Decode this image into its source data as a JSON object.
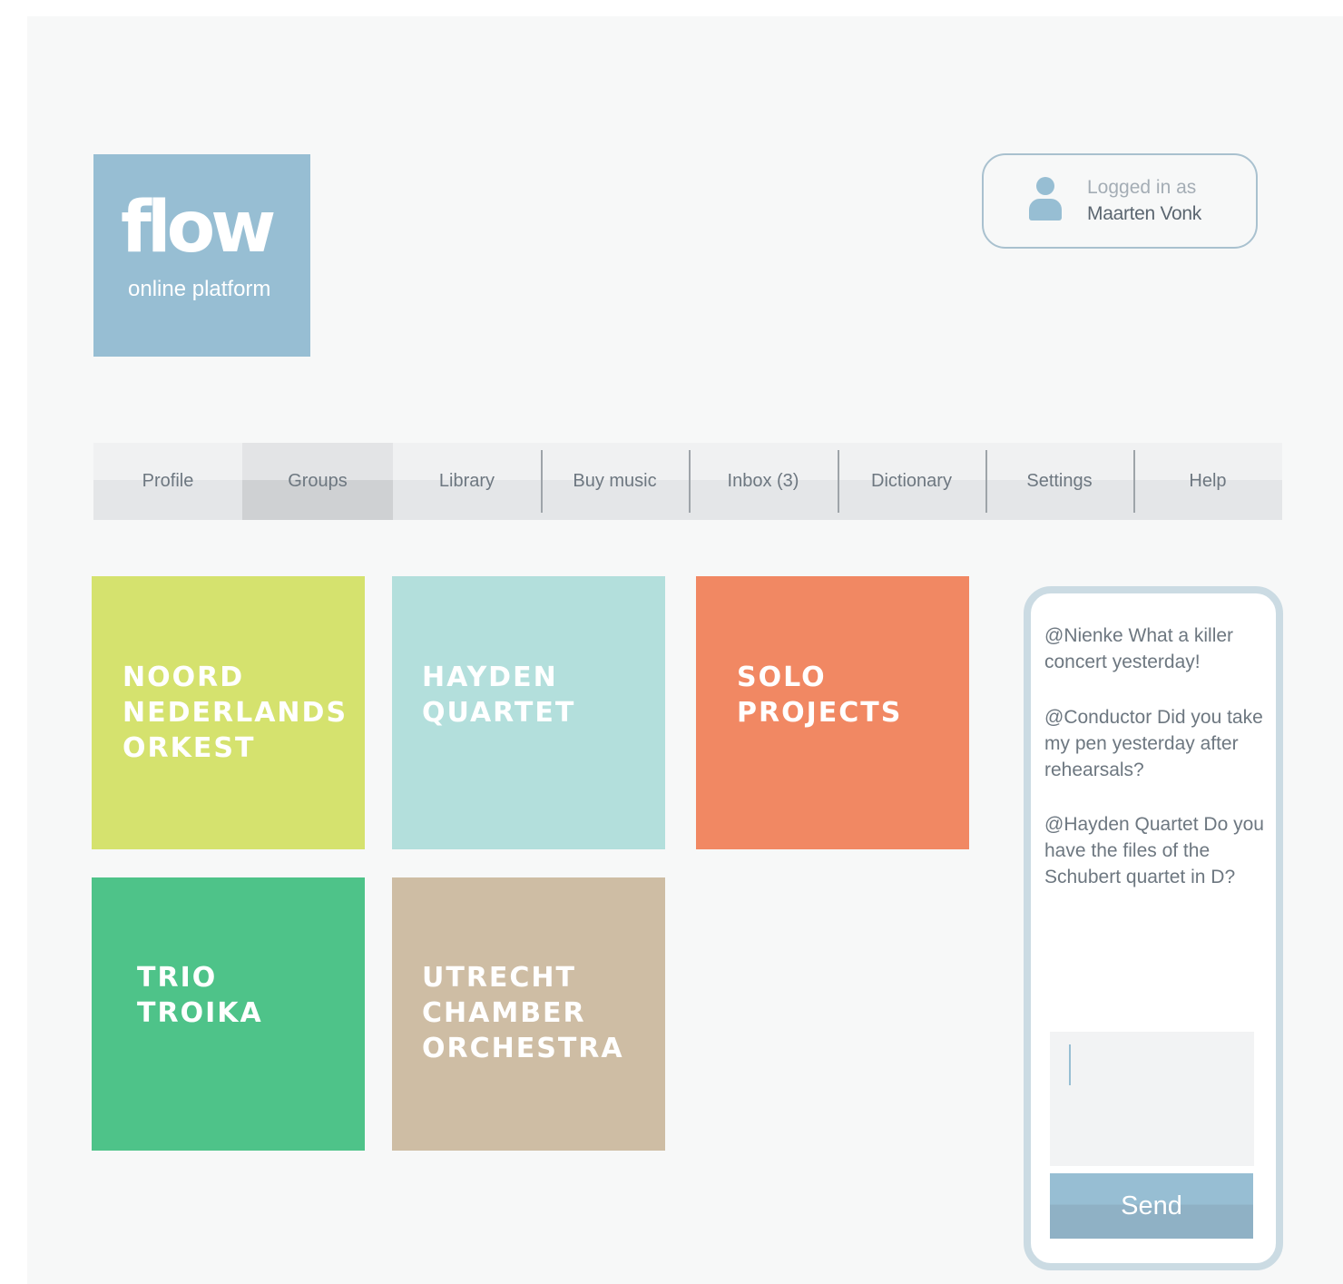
{
  "brand": {
    "logo_text": "flow",
    "tagline": "online platform",
    "color": "#97bed3"
  },
  "login": {
    "label": "Logged in as",
    "user": "Maarten Vonk",
    "icon": "user-icon"
  },
  "nav": {
    "active": "Groups",
    "items": [
      {
        "label": "Profile"
      },
      {
        "label": "Groups"
      },
      {
        "label": "Library"
      },
      {
        "label": "Buy music"
      },
      {
        "label": "Inbox (3)"
      },
      {
        "label": "Dictionary"
      },
      {
        "label": "Settings"
      },
      {
        "label": "Help"
      }
    ]
  },
  "groups": [
    {
      "name": "NOORD\nNEDERLANDS\nORKEST",
      "color": "#d5e26e"
    },
    {
      "name": "HAYDEN\nQUARTET",
      "color": "#b3dfdc"
    },
    {
      "name": "SOLO\nPROJECTS",
      "color": "#f18863"
    },
    {
      "name": "TRIO\nTROIKA",
      "color": "#4ec389"
    },
    {
      "name": "UTRECHT\nCHAMBER\nORCHESTRA",
      "color": "#cebda4"
    }
  ],
  "chat": {
    "messages": [
      "@Nienke What a killer concert yesterday!",
      "@Conductor Did you take my pen yesterday after rehearsals?",
      "@Hayden Quartet Do you have the files of the Schubert quartet in D?"
    ],
    "input_value": "",
    "send_label": "Send"
  }
}
